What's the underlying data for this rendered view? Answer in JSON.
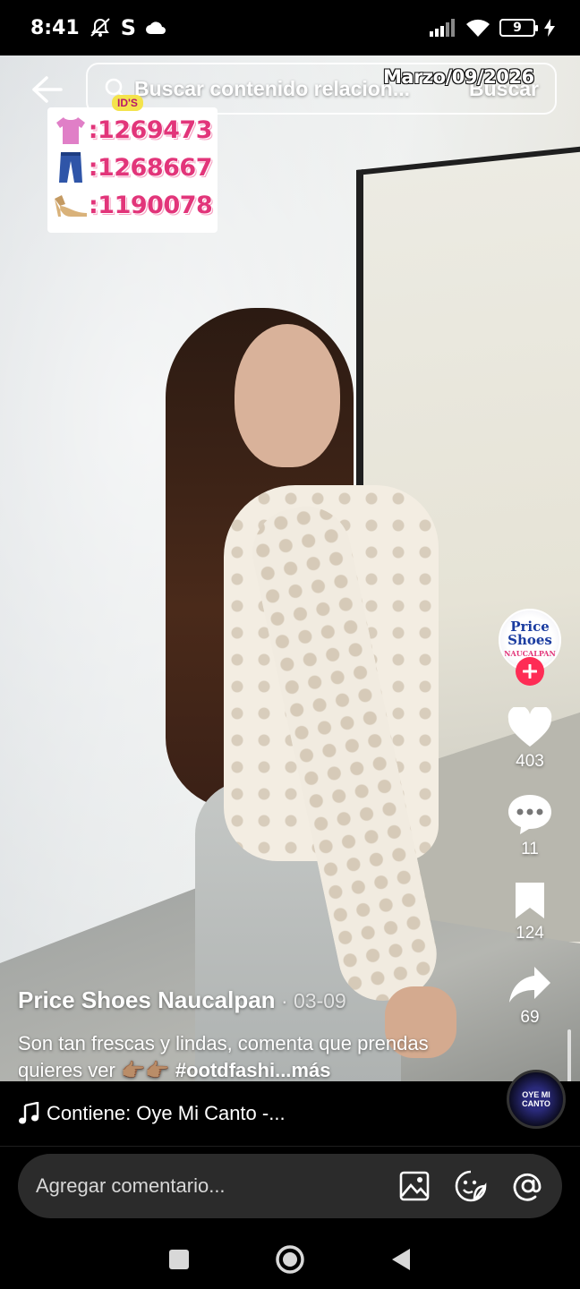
{
  "status_bar": {
    "time": "8:41",
    "carrier_letter": "S",
    "battery": "9",
    "icons": [
      "mute-icon",
      "s-icon",
      "cloud-icon",
      "signal-icon",
      "wifi-icon",
      "battery-icon",
      "charging-icon"
    ]
  },
  "search": {
    "placeholder": "Buscar contenido relacion...",
    "button_label": "Buscar"
  },
  "overlay": {
    "date_stamp": "Marzo/09/2026",
    "ids_tag": "ID'S",
    "ids": [
      {
        "item": "blouse",
        "icon": "blouse-icon",
        "value": ":1269473"
      },
      {
        "item": "jeans",
        "icon": "jeans-icon",
        "value": ":1268667"
      },
      {
        "item": "heel",
        "icon": "heel-icon",
        "value": ":1190078"
      }
    ]
  },
  "actions": {
    "avatar_name": "Price Shoes",
    "avatar_sub": "NAUCALPAN",
    "likes": "403",
    "comments": "11",
    "saves": "124",
    "shares": "69"
  },
  "caption": {
    "author": "Price Shoes Naucalpan",
    "date": " · 03-09",
    "text": "Son tan frescas y lindas, comenta que prendas quieres ver 👉🏽👉🏽 ",
    "hashtag": "#ootdfashi",
    "more": "...más"
  },
  "sound": {
    "text": "Contiene: Oye Mi Canto -...",
    "disc_label": "OYE MI CANTO"
  },
  "comment": {
    "placeholder": "Agregar comentario..."
  },
  "colors": {
    "follow_red": "#fe2c55",
    "id_pink": "#e2357a",
    "tag_yellow": "#f4e34c"
  }
}
